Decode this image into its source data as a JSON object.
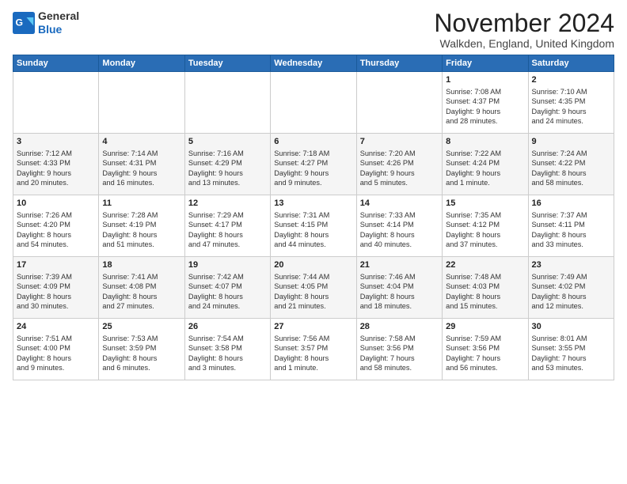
{
  "header": {
    "logo_general": "General",
    "logo_blue": "Blue",
    "month_title": "November 2024",
    "subtitle": "Walkden, England, United Kingdom"
  },
  "weekdays": [
    "Sunday",
    "Monday",
    "Tuesday",
    "Wednesday",
    "Thursday",
    "Friday",
    "Saturday"
  ],
  "weeks": [
    [
      {
        "day": "",
        "info": ""
      },
      {
        "day": "",
        "info": ""
      },
      {
        "day": "",
        "info": ""
      },
      {
        "day": "",
        "info": ""
      },
      {
        "day": "",
        "info": ""
      },
      {
        "day": "1",
        "info": "Sunrise: 7:08 AM\nSunset: 4:37 PM\nDaylight: 9 hours\nand 28 minutes."
      },
      {
        "day": "2",
        "info": "Sunrise: 7:10 AM\nSunset: 4:35 PM\nDaylight: 9 hours\nand 24 minutes."
      }
    ],
    [
      {
        "day": "3",
        "info": "Sunrise: 7:12 AM\nSunset: 4:33 PM\nDaylight: 9 hours\nand 20 minutes."
      },
      {
        "day": "4",
        "info": "Sunrise: 7:14 AM\nSunset: 4:31 PM\nDaylight: 9 hours\nand 16 minutes."
      },
      {
        "day": "5",
        "info": "Sunrise: 7:16 AM\nSunset: 4:29 PM\nDaylight: 9 hours\nand 13 minutes."
      },
      {
        "day": "6",
        "info": "Sunrise: 7:18 AM\nSunset: 4:27 PM\nDaylight: 9 hours\nand 9 minutes."
      },
      {
        "day": "7",
        "info": "Sunrise: 7:20 AM\nSunset: 4:26 PM\nDaylight: 9 hours\nand 5 minutes."
      },
      {
        "day": "8",
        "info": "Sunrise: 7:22 AM\nSunset: 4:24 PM\nDaylight: 9 hours\nand 1 minute."
      },
      {
        "day": "9",
        "info": "Sunrise: 7:24 AM\nSunset: 4:22 PM\nDaylight: 8 hours\nand 58 minutes."
      }
    ],
    [
      {
        "day": "10",
        "info": "Sunrise: 7:26 AM\nSunset: 4:20 PM\nDaylight: 8 hours\nand 54 minutes."
      },
      {
        "day": "11",
        "info": "Sunrise: 7:28 AM\nSunset: 4:19 PM\nDaylight: 8 hours\nand 51 minutes."
      },
      {
        "day": "12",
        "info": "Sunrise: 7:29 AM\nSunset: 4:17 PM\nDaylight: 8 hours\nand 47 minutes."
      },
      {
        "day": "13",
        "info": "Sunrise: 7:31 AM\nSunset: 4:15 PM\nDaylight: 8 hours\nand 44 minutes."
      },
      {
        "day": "14",
        "info": "Sunrise: 7:33 AM\nSunset: 4:14 PM\nDaylight: 8 hours\nand 40 minutes."
      },
      {
        "day": "15",
        "info": "Sunrise: 7:35 AM\nSunset: 4:12 PM\nDaylight: 8 hours\nand 37 minutes."
      },
      {
        "day": "16",
        "info": "Sunrise: 7:37 AM\nSunset: 4:11 PM\nDaylight: 8 hours\nand 33 minutes."
      }
    ],
    [
      {
        "day": "17",
        "info": "Sunrise: 7:39 AM\nSunset: 4:09 PM\nDaylight: 8 hours\nand 30 minutes."
      },
      {
        "day": "18",
        "info": "Sunrise: 7:41 AM\nSunset: 4:08 PM\nDaylight: 8 hours\nand 27 minutes."
      },
      {
        "day": "19",
        "info": "Sunrise: 7:42 AM\nSunset: 4:07 PM\nDaylight: 8 hours\nand 24 minutes."
      },
      {
        "day": "20",
        "info": "Sunrise: 7:44 AM\nSunset: 4:05 PM\nDaylight: 8 hours\nand 21 minutes."
      },
      {
        "day": "21",
        "info": "Sunrise: 7:46 AM\nSunset: 4:04 PM\nDaylight: 8 hours\nand 18 minutes."
      },
      {
        "day": "22",
        "info": "Sunrise: 7:48 AM\nSunset: 4:03 PM\nDaylight: 8 hours\nand 15 minutes."
      },
      {
        "day": "23",
        "info": "Sunrise: 7:49 AM\nSunset: 4:02 PM\nDaylight: 8 hours\nand 12 minutes."
      }
    ],
    [
      {
        "day": "24",
        "info": "Sunrise: 7:51 AM\nSunset: 4:00 PM\nDaylight: 8 hours\nand 9 minutes."
      },
      {
        "day": "25",
        "info": "Sunrise: 7:53 AM\nSunset: 3:59 PM\nDaylight: 8 hours\nand 6 minutes."
      },
      {
        "day": "26",
        "info": "Sunrise: 7:54 AM\nSunset: 3:58 PM\nDaylight: 8 hours\nand 3 minutes."
      },
      {
        "day": "27",
        "info": "Sunrise: 7:56 AM\nSunset: 3:57 PM\nDaylight: 8 hours\nand 1 minute."
      },
      {
        "day": "28",
        "info": "Sunrise: 7:58 AM\nSunset: 3:56 PM\nDaylight: 7 hours\nand 58 minutes."
      },
      {
        "day": "29",
        "info": "Sunrise: 7:59 AM\nSunset: 3:56 PM\nDaylight: 7 hours\nand 56 minutes."
      },
      {
        "day": "30",
        "info": "Sunrise: 8:01 AM\nSunset: 3:55 PM\nDaylight: 7 hours\nand 53 minutes."
      }
    ]
  ]
}
